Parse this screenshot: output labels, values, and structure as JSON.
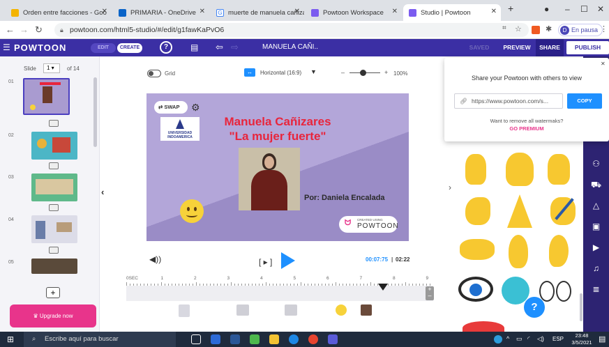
{
  "browser": {
    "tabs": [
      {
        "title": "Orden entre facciones - Goo",
        "color": "#f4b400"
      },
      {
        "title": "PRIMARIA - OneDrive",
        "color": "#0a64c8"
      },
      {
        "title": "muerte de manuela cañizare",
        "color": "#4285f4"
      },
      {
        "title": "Powtoon Workspace",
        "color": "#7b5cf0"
      },
      {
        "title": "Studio | Powtoon",
        "color": "#7b5cf0"
      }
    ],
    "url": "powtoon.com/html5-studio/#/edit/g1fawKaPvO6",
    "profile_initial": "D",
    "profile_status": "En pausa"
  },
  "app": {
    "logo": "POWTOON",
    "mode_edit": "EDIT",
    "mode_create": "CREATE",
    "doc_title": "MANUELA CAÑI..",
    "saved": "SAVED",
    "preview": "PREVIEW",
    "share": "SHARE",
    "publish": "PUBLISH"
  },
  "left": {
    "slide_label": "Slide",
    "slide_current": "1",
    "slide_total": "of 14",
    "slides": [
      "01",
      "02",
      "03",
      "04",
      "05"
    ],
    "upgrade": "Upgrade now"
  },
  "canvas": {
    "grid_label": "Grid",
    "orientation": "Horizontal (16:9)",
    "zoom": "100%",
    "swap_label": "SWAP",
    "title_line1": "Manuela Cañizares",
    "title_line2": "\"La mujer fuerte\"",
    "byline": "Por: Daniela Encalada",
    "watermark_small": "CREATED USING",
    "watermark_big": "POWTOON",
    "university": "UNIVERSIDAD INDOAMERICA",
    "time_current": "00:07:75",
    "time_total": "02:22",
    "timeline_ticks": [
      "0SEC",
      "1",
      "2",
      "3",
      "4",
      "5",
      "6",
      "7",
      "8",
      "9"
    ]
  },
  "share": {
    "title": "Share your Powtoon with others to view",
    "link": "https://www.powtoon.com/s...",
    "copy": "COPY",
    "watermark_msg": "Want to remove all watermaks?",
    "premium": "GO PREMIUM"
  },
  "taskbar": {
    "search": "Escribe aquí para buscar",
    "lang": "ESP",
    "time": "23:48",
    "date": "3/5/2021"
  },
  "colors": {
    "header": "#3b2fa4",
    "accent": "#1e90ff",
    "slide_bg": "#a99bd0",
    "title_red": "#e8253c",
    "upgrade": "#e8348b"
  }
}
